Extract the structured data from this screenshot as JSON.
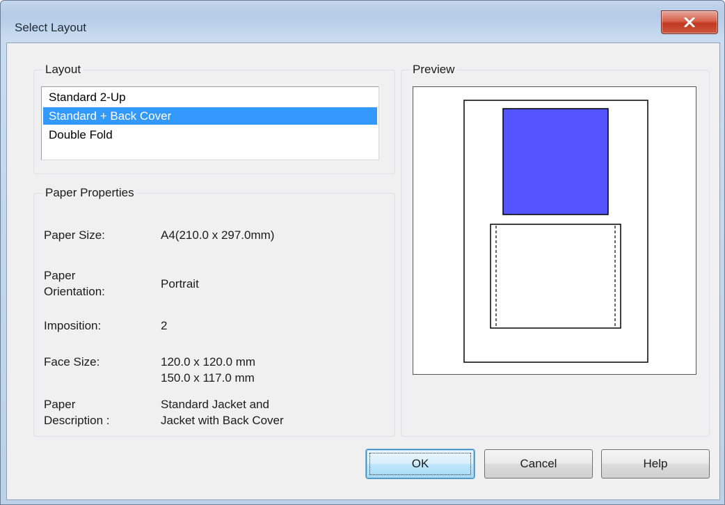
{
  "window": {
    "title": "Select Layout",
    "close_icon": "close-x-icon"
  },
  "layout_group": {
    "legend": "Layout",
    "items": [
      {
        "label": "Standard 2-Up",
        "selected": false
      },
      {
        "label": "Standard + Back Cover",
        "selected": true
      },
      {
        "label": "Double Fold",
        "selected": false
      }
    ]
  },
  "paper_group": {
    "legend": "Paper Properties",
    "paper_size": {
      "label": "Paper Size:",
      "value": "A4(210.0 x 297.0mm)"
    },
    "orientation": {
      "label_line1": "Paper",
      "label_line2": "Orientation:",
      "value": "Portrait"
    },
    "imposition": {
      "label": "Imposition:",
      "value": "2"
    },
    "face_size": {
      "label": "Face Size:",
      "value_line1": "120.0 x 120.0 mm",
      "value_line2": "150.0 x 117.0 mm"
    },
    "description": {
      "label_line1": "Paper",
      "label_line2": "Description :",
      "value_line1": "Standard Jacket and",
      "value_line2": "Jacket with Back Cover"
    }
  },
  "preview_group": {
    "legend": "Preview",
    "colors": {
      "face_fill": "#5555ff",
      "sheet_stroke": "#000000"
    }
  },
  "buttons": {
    "ok": "OK",
    "cancel": "Cancel",
    "help": "Help"
  }
}
